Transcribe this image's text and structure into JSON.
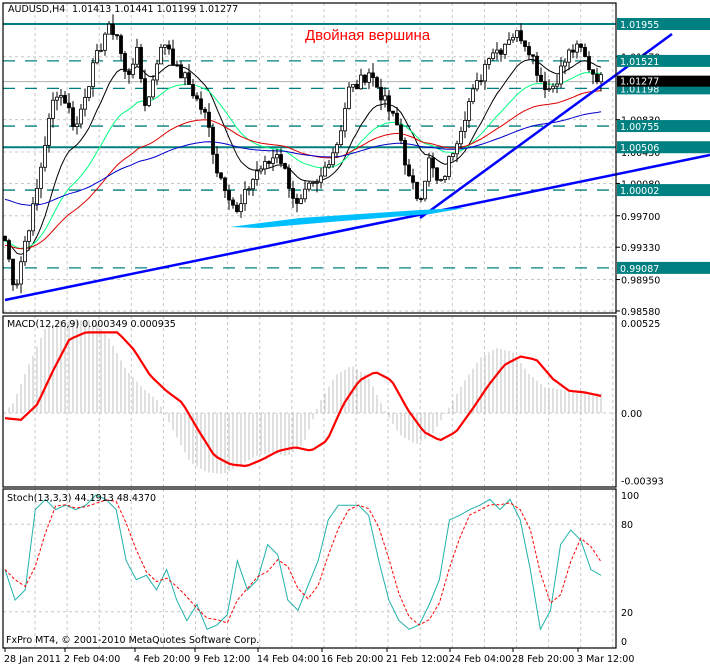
{
  "header": {
    "symbol": "AUDUSD,H4",
    "ohlc": "1.01413 1.01441 1.01199 1.01277"
  },
  "annotation": "Двойная вершина",
  "copyright": "FxPro MT4, © 2001-2010 MetaQuotes Software Corp.",
  "colors": {
    "level": "#008080",
    "trend": "#0000ff",
    "cyan": "#00bfff",
    "signal": "#ff0000",
    "hist": "#c0c0c0",
    "stoch_k": "#20b2aa",
    "stoch_d": "#ff0000",
    "ma1": "#000000",
    "ma2": "#00ff7f",
    "ma3": "#dd0000",
    "ma4": "#0000cd"
  },
  "chart_data": [
    {
      "type": "candlestick",
      "title": "AUDUSD,H4",
      "ylim": [
        0.9858,
        1.01955
      ],
      "price_ticks": [
        "1.01570",
        "1.00830",
        "1.00450",
        "1.00080",
        "0.99700",
        "0.99330",
        "0.98950",
        "0.98580"
      ],
      "levels": [
        {
          "value": 1.01955,
          "label": "1.01955",
          "style": "solid"
        },
        {
          "value": 1.01521,
          "label": "1.01521",
          "style": "dashed"
        },
        {
          "value": 1.01198,
          "label": "1.01198",
          "style": "dashed"
        },
        {
          "value": 1.00755,
          "label": "1.00755",
          "style": "dashed"
        },
        {
          "value": 1.00506,
          "label": "1.00506",
          "style": "solid"
        },
        {
          "value": 1.00002,
          "label": "1.00002",
          "style": "dashed"
        },
        {
          "value": 0.99087,
          "label": "0.99087",
          "style": "dashed"
        }
      ],
      "bid": {
        "value": 1.01277,
        "label": "1.01277"
      },
      "close_path": [
        0.9941,
        0.9883,
        0.9941,
        0.9989,
        1.0059,
        1.0118,
        1.0106,
        1.0071,
        1.0118,
        1.0153,
        1.0188,
        1.0188,
        1.013,
        1.0165,
        1.0094,
        1.0153,
        1.0177,
        1.0141,
        1.013,
        1.0106,
        1.0083,
        1.0024,
        1.0001,
        0.9971,
        1.0001,
        1.0024,
        1.003,
        1.0047,
        1.0012,
        0.9977,
        1.0001,
        1.0006,
        1.0036,
        1.0059,
        1.0118,
        1.0124,
        1.0141,
        1.0118,
        1.0094,
        1.0071,
        1.0012,
        0.9989,
        1.0036,
        1.0001,
        1.0036,
        1.0071,
        1.0106,
        1.013,
        1.0165,
        1.0165,
        1.0183,
        1.0183,
        1.0165,
        1.013,
        1.0118,
        1.0141,
        1.0165,
        1.0165,
        1.0141,
        1.013
      ],
      "x_ticks": [
        "28 Jan 2011",
        "2 Feb 04:00",
        "4 Feb 20:00",
        "9 Feb 12:00",
        "14 Feb 04:00",
        "16 Feb 20:00",
        "21 Feb 12:00",
        "24 Feb 04:00",
        "28 Feb 20:00",
        "3 Mar 12:00"
      ]
    },
    {
      "type": "line",
      "title": "MACD(12,26,9) 0.000349 0.000935",
      "ylim": [
        -0.00393,
        0.00525
      ],
      "ticks": [
        "0.00525",
        "0.00",
        "-0.00393"
      ],
      "signal": [
        -0.0003,
        -0.0004,
        0.0005,
        0.0025,
        0.0043,
        0.0047,
        0.0047,
        0.0047,
        0.0037,
        0.0022,
        0.0013,
        0.0006,
        -0.001,
        -0.0025,
        -0.003,
        -0.0031,
        -0.0027,
        -0.0022,
        -0.002,
        -0.0022,
        -0.0016,
        0.0005,
        0.0019,
        0.0024,
        0.0019,
        0.0002,
        -0.0011,
        -0.0016,
        -0.0011,
        0.0002,
        0.0016,
        0.0028,
        0.0033,
        0.0031,
        0.002,
        0.0013,
        0.0012,
        0.001
      ]
    },
    {
      "type": "line",
      "title": "Stoch(13,3,3) 44.1913 48.4370",
      "ylim": [
        0,
        100
      ],
      "ticks": [
        "100",
        "80",
        "20",
        "0"
      ],
      "k": [
        49,
        28,
        35,
        90,
        97,
        90,
        93,
        90,
        93,
        100,
        97,
        90,
        55,
        42,
        45,
        35,
        49,
        28,
        14,
        25,
        8,
        11,
        18,
        55,
        35,
        42,
        66,
        59,
        28,
        21,
        38,
        55,
        83,
        93,
        93,
        93,
        86,
        55,
        28,
        14,
        8,
        11,
        25,
        42,
        83,
        86,
        90,
        93,
        97,
        90,
        97,
        83,
        49,
        8,
        21,
        66,
        76,
        69,
        49,
        45
      ]
    }
  ]
}
